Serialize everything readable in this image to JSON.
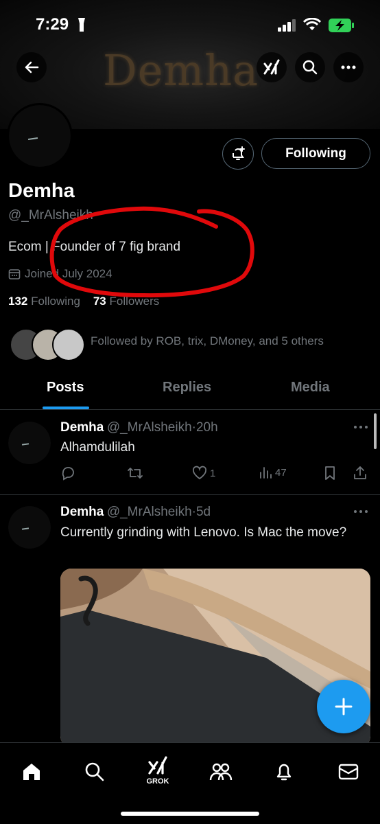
{
  "status_bar": {
    "time": "7:29"
  },
  "header": {
    "banner_text": "Demha"
  },
  "profile": {
    "name": "Demha",
    "handle": "@_MrAlsheikh",
    "bio": "Ecom | Founder of 7 fig brand",
    "joined": "Joined July 2024",
    "following_count": "132",
    "following_label": "Following",
    "followers_count": "73",
    "followers_label": "Followers",
    "followed_by": "Followed by ROB, trix, DMoney, and 5 others",
    "follow_button": "Following"
  },
  "tabs": [
    {
      "label": "Posts",
      "active": true
    },
    {
      "label": "Replies",
      "active": false
    },
    {
      "label": "Media",
      "active": false
    }
  ],
  "posts": [
    {
      "name": "Demha",
      "handle": "@_MrAlsheikh",
      "time": "20h",
      "text": "Alhamdulilah",
      "likes": "1",
      "views": "47"
    },
    {
      "name": "Demha",
      "handle": "@_MrAlsheikh",
      "time": "5d",
      "text": "Currently grinding with Lenovo. Is Mac the move?"
    }
  ],
  "nav": {
    "grok_label": "GROK"
  },
  "colors": {
    "accent": "#1d9bf0",
    "annotation": "#e0090b"
  }
}
